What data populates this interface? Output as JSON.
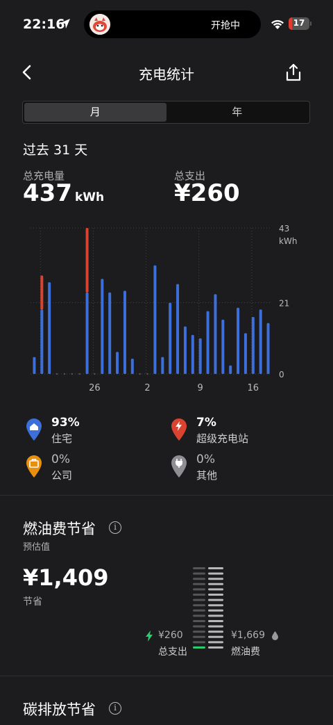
{
  "status_bar": {
    "time": "22:16",
    "island_text": "开抢中",
    "battery": "17",
    "battery_level": 0.17
  },
  "nav": {
    "title": "充电统计"
  },
  "segments": [
    {
      "label": "月",
      "active": true
    },
    {
      "label": "年",
      "active": false
    }
  ],
  "period": "过去 31 天",
  "stats": {
    "energy_label": "总充电量",
    "energy_value": "437",
    "energy_unit": "kWh",
    "spend_label": "总支出",
    "spend_value": "¥260"
  },
  "chart_data": {
    "type": "bar",
    "stacked": true,
    "x_tick_labels": [
      "26",
      "2",
      "9",
      "16"
    ],
    "y_ticks": [
      "0",
      "21",
      "43"
    ],
    "y_unit": "kWh",
    "ylim": [
      0,
      43
    ],
    "grid": true,
    "colors": {
      "home": "#3d6fdb",
      "supercharger": "#d9432f"
    },
    "days": [
      {
        "home": 5,
        "supercharger": 0
      },
      {
        "home": 19,
        "supercharger": 10
      },
      {
        "home": 27,
        "supercharger": 0
      },
      {
        "home": 0,
        "supercharger": 0
      },
      {
        "home": 0,
        "supercharger": 0
      },
      {
        "home": 0,
        "supercharger": 0
      },
      {
        "home": 0,
        "supercharger": 0
      },
      {
        "home": 24,
        "supercharger": 19
      },
      {
        "home": 0,
        "supercharger": 0
      },
      {
        "home": 28,
        "supercharger": 0
      },
      {
        "home": 24,
        "supercharger": 0
      },
      {
        "home": 6.5,
        "supercharger": 0
      },
      {
        "home": 24.5,
        "supercharger": 0
      },
      {
        "home": 4.5,
        "supercharger": 0
      },
      {
        "home": 0,
        "supercharger": 0
      },
      {
        "home": 0,
        "supercharger": 0
      },
      {
        "home": 32,
        "supercharger": 0
      },
      {
        "home": 5,
        "supercharger": 0
      },
      {
        "home": 21,
        "supercharger": 0
      },
      {
        "home": 26.5,
        "supercharger": 0
      },
      {
        "home": 14,
        "supercharger": 0
      },
      {
        "home": 11.5,
        "supercharger": 0
      },
      {
        "home": 10.5,
        "supercharger": 0
      },
      {
        "home": 18.5,
        "supercharger": 0
      },
      {
        "home": 23.5,
        "supercharger": 0
      },
      {
        "home": 16,
        "supercharger": 0
      },
      {
        "home": 2.5,
        "supercharger": 0
      },
      {
        "home": 19.5,
        "supercharger": 0
      },
      {
        "home": 12,
        "supercharger": 0
      },
      {
        "home": 16.8,
        "supercharger": 0
      },
      {
        "home": 19,
        "supercharger": 0
      },
      {
        "home": 15,
        "supercharger": 0
      }
    ]
  },
  "legend": [
    {
      "pct": "93%",
      "name": "住宅",
      "color": "#3d6fdb",
      "icon": "home-pin-icon"
    },
    {
      "pct": "7%",
      "name": "超级充电站",
      "color": "#d9432f",
      "icon": "bolt-pin-icon"
    },
    {
      "pct": "0%",
      "name": "公司",
      "color": "#e8900e",
      "icon": "briefcase-pin-icon"
    },
    {
      "pct": "0%",
      "name": "其他",
      "color": "#8e8e93",
      "icon": "plug-pin-icon"
    }
  ],
  "fuel": {
    "title": "燃油费节省",
    "subtitle": "预估值",
    "saving_value": "¥1,409",
    "saving_label": "节省",
    "spend_amount": "¥260",
    "spend_label": "总支出",
    "fuel_amount": "¥1,669",
    "fuel_label": "燃油费",
    "spend_color": "#2ecc71",
    "spend_ratio": 0.156
  },
  "carbon": {
    "title": "碳排放节省"
  }
}
